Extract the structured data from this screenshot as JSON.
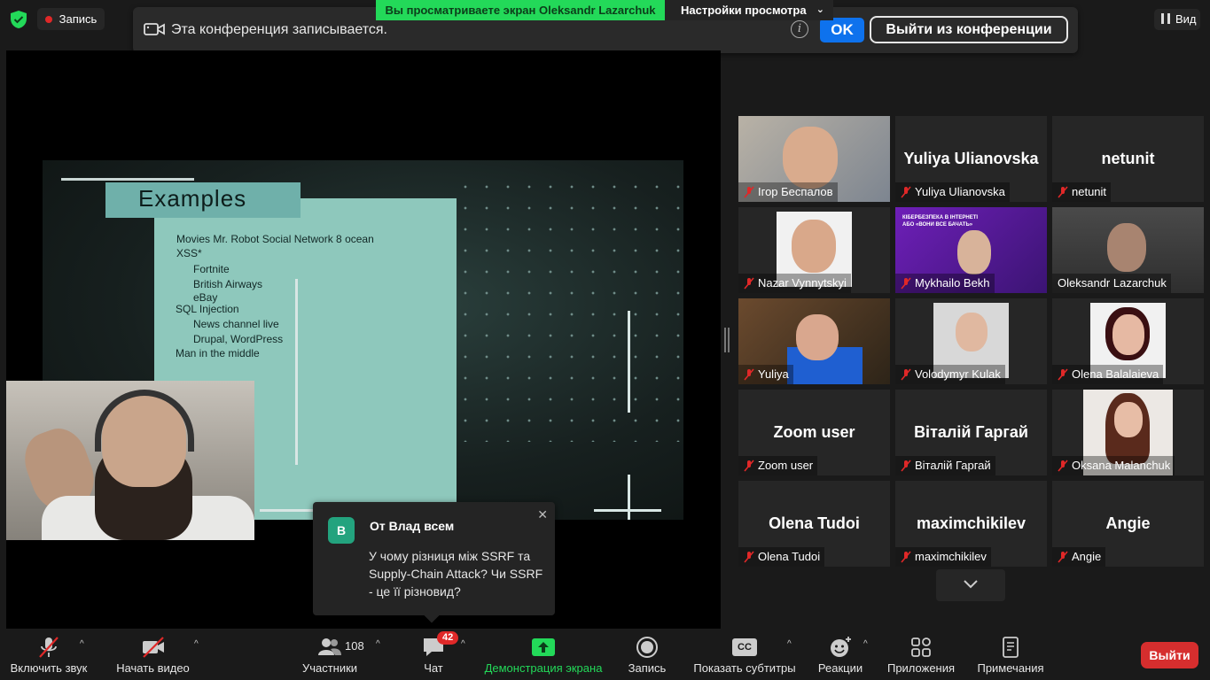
{
  "top": {
    "record_label": "Запись",
    "viewing_text": "Вы просматриваете экран Oleksandr Lazarchuk",
    "view_options_label": "Настройки просмотра",
    "view_button_label": "Вид"
  },
  "banner": {
    "message": "Эта конференция записывается.",
    "info": "i",
    "ok_label": "OK",
    "leave_label": "Выйти из конференции"
  },
  "slide": {
    "title": "Examples",
    "lines": [
      "Movies   Mr. Robot  Social Network   8 ocean",
      "XSS*",
      "Fortnite",
      "British Airways",
      "eBay",
      "SQL Injection",
      "News channel live",
      "Drupal, WordPress",
      "Man in the middle"
    ]
  },
  "chat_popup": {
    "avatar_letter": "В",
    "from": "От Влад всем",
    "message": "У чому різниця між SSRF та Supply-Chain Attack? Чи SSRF - це її різновид?"
  },
  "participants": [
    {
      "name": "Ігор Беспалов",
      "big": ""
    },
    {
      "name": "Yuliya Ulianovska",
      "big": "Yuliya Ulianovska"
    },
    {
      "name": "netunit",
      "big": "netunit"
    },
    {
      "name": "Nazar Vynnytskyi",
      "big": ""
    },
    {
      "name": "Mykhailo Bekh",
      "big": ""
    },
    {
      "name": "Oleksandr Lazarchuk",
      "big": ""
    },
    {
      "name": "Yuliya",
      "big": ""
    },
    {
      "name": "Volodymyr Kulak",
      "big": ""
    },
    {
      "name": "Olena Balalaieva",
      "big": ""
    },
    {
      "name": "Zoom user",
      "big": "Zoom user"
    },
    {
      "name": "Віталій Гаргай",
      "big": "Віталій Гаргай"
    },
    {
      "name": "Oksana Malanchuk",
      "big": ""
    },
    {
      "name": "Olena Tudoi",
      "big": "Olena Tudoi"
    },
    {
      "name": "maximchikilev",
      "big": "maximchikilev"
    },
    {
      "name": "Angie",
      "big": "Angie"
    }
  ],
  "mykhailo_bg_text": "КІБЕРБЕЗПЕКА В ІНТЕРНЕТІ АБО «ВОНИ ВСЕ БАЧАТЬ»",
  "toolbar": {
    "unmute": "Включить звук",
    "start_video": "Начать видео",
    "participants": "Участники",
    "participants_count": "108",
    "chat": "Чат",
    "chat_badge": "42",
    "share": "Демонстрация экрана",
    "record": "Запись",
    "captions": "Показать субтитры",
    "captions_icon": "CC",
    "reactions": "Реакции",
    "apps": "Приложения",
    "notes": "Примечания",
    "leave": "Выйти"
  },
  "colors": {
    "accent_green": "#23d959",
    "ok_blue": "#0e72ed",
    "leave_red": "#d62e2e",
    "active_speaker": "#c8e36b"
  }
}
